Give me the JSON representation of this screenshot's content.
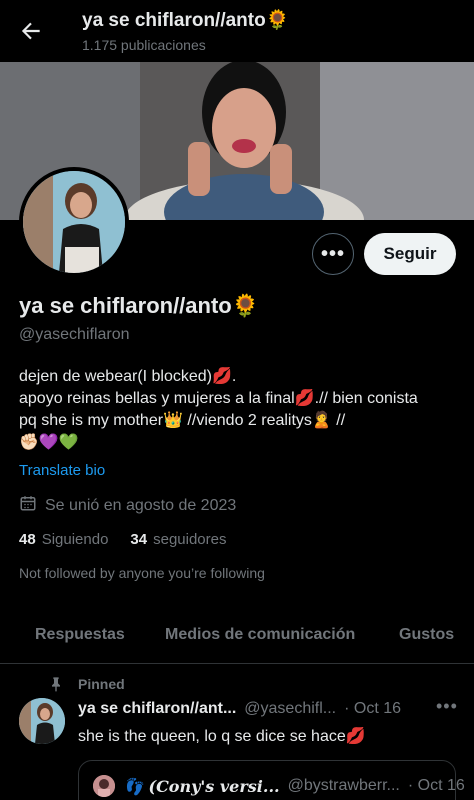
{
  "header": {
    "title": "ya se chiflaron//anto🌻",
    "subtitle": "1.175 publicaciones"
  },
  "profile": {
    "name": "ya se chiflaron//anto🌻",
    "handle": "@yasechiflaron",
    "follow_label": "Seguir",
    "more_label": "•••",
    "bio_lines": [
      "dejen de webear(I blocked)💋.",
      "apoyo reinas bellas y mujeres a la final💋.// bien conista",
      "pq she is my mother👑 //viendo 2 realitys🙎 //",
      "✊🏻💜💚"
    ],
    "translate_label": "Translate bio",
    "joined": "Se unió en agosto de 2023",
    "following_count": "48",
    "following_label": "Siguiendo",
    "followers_count": "34",
    "followers_label": "seguidores",
    "not_followed": "Not followed by anyone you’re following"
  },
  "tabs": [
    "Respuestas",
    "Medios de comunicación",
    "Gustos"
  ],
  "post": {
    "pinned_label": "Pinned",
    "name": "ya se chiflaron//ant...",
    "handle": "@yasechifl...",
    "date": "· Oct 16",
    "more": "•••",
    "text": "she is the queen, lo q se dice se hace💋",
    "quote": {
      "name": "👣 (𝑪𝒐𝒏𝒚'𝒔 𝒗𝒆𝒓𝒔𝒊...",
      "handle": "@bystrawberr...",
      "date": "· Oct 16"
    }
  },
  "colors": {
    "background": "#000000",
    "text": "#e7e9ea",
    "muted": "#71767b",
    "link": "#1d9bf0",
    "button_bg": "#eff3f4"
  },
  "icons": [
    "back-arrow-icon",
    "calendar-icon",
    "pin-icon",
    "more-icon"
  ]
}
